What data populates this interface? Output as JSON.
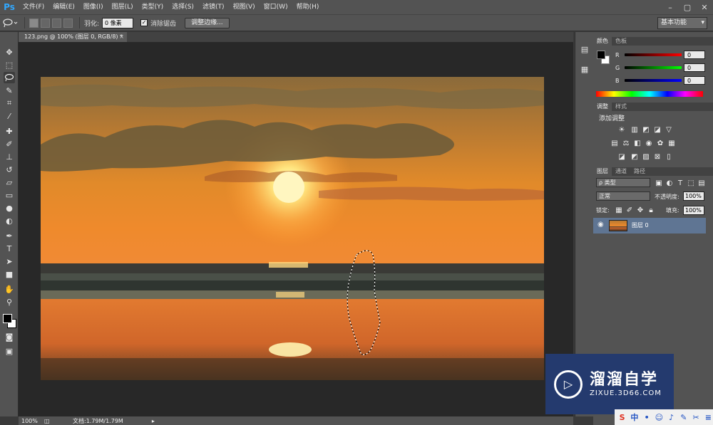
{
  "app": {
    "logo": "Ps"
  },
  "menu": [
    "文件(F)",
    "编辑(E)",
    "图像(I)",
    "图层(L)",
    "类型(Y)",
    "选择(S)",
    "滤镜(T)",
    "视图(V)",
    "窗口(W)",
    "帮助(H)"
  ],
  "window_controls": {
    "minimize": "–",
    "restore": "▢",
    "close": "✕"
  },
  "options": {
    "feather_label": "羽化:",
    "feather_value": "0 像素",
    "antialias_label": "消除锯齿",
    "antialias_checked": true,
    "refine_edge": "调整边缘...",
    "workspace": "基本功能"
  },
  "document": {
    "tab_title": "123.png @ 100% (图层 0, RGB/8) *",
    "close": "×"
  },
  "status": {
    "zoom": "100%",
    "doc_info": "文档:1.79M/1.79M"
  },
  "color_panel": {
    "tabs": [
      "颜色",
      "色板"
    ],
    "r_label": "R",
    "r_value": "0",
    "g_label": "G",
    "g_value": "0",
    "b_label": "B",
    "b_value": "0"
  },
  "adjust_panel": {
    "tabs": [
      "调整",
      "样式"
    ],
    "heading": "添加调整"
  },
  "layers_panel": {
    "tabs": [
      "图层",
      "通道",
      "路径"
    ],
    "filter_kind": "ρ 类型",
    "blend_mode": "正常",
    "opacity_label": "不透明度:",
    "opacity_value": "100%",
    "lock_label": "锁定:",
    "fill_label": "填充:",
    "fill_value": "100%",
    "layers": [
      {
        "name": "图层 0",
        "visible": true
      }
    ]
  },
  "watermark": {
    "title": "溜溜自学",
    "url": "ZIXUE.3D66.COM"
  },
  "colors": {
    "accent": "#31a8ff",
    "panel_bg": "#535353",
    "canvas_bg": "#282828",
    "layer_selected": "#5f7593",
    "watermark_bg": "#243a6e"
  }
}
